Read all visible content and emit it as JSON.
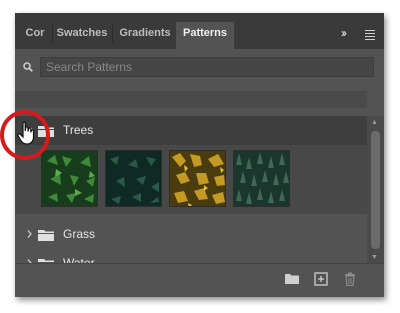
{
  "tabs": [
    {
      "label": "Cor",
      "active": false
    },
    {
      "label": "Swatches",
      "active": false
    },
    {
      "label": "Gradients",
      "active": false
    },
    {
      "label": "Patterns",
      "active": true
    }
  ],
  "search": {
    "placeholder": "Search Patterns",
    "value": ""
  },
  "groups": [
    {
      "label": "Trees",
      "expanded": true,
      "selected": true
    },
    {
      "label": "Grass",
      "expanded": false
    },
    {
      "label": "Water",
      "expanded": false
    }
  ],
  "patterns": [
    {
      "name": "green-leaves-pattern",
      "base": "#1f4a22",
      "accent": "#3f8a3a"
    },
    {
      "name": "dark-green-leaves-pattern",
      "base": "#12302a",
      "accent": "#2a5a45"
    },
    {
      "name": "yellow-autumn-trees-pattern",
      "base": "#5a4a10",
      "accent": "#c49a22"
    },
    {
      "name": "pine-forest-pattern",
      "base": "#1d3a30",
      "accent": "#3e6a55"
    }
  ],
  "colors": {
    "panel_bg": "#535353",
    "tab_bar_bg": "#3a3a3a",
    "highlight_circle": "#d41a1a"
  },
  "icons": [
    "search-icon",
    "panel-menu-icon",
    "expand-panels-icon",
    "folder-icon",
    "new-group-icon",
    "new-pattern-icon",
    "trash-icon",
    "hand-cursor-icon"
  ]
}
